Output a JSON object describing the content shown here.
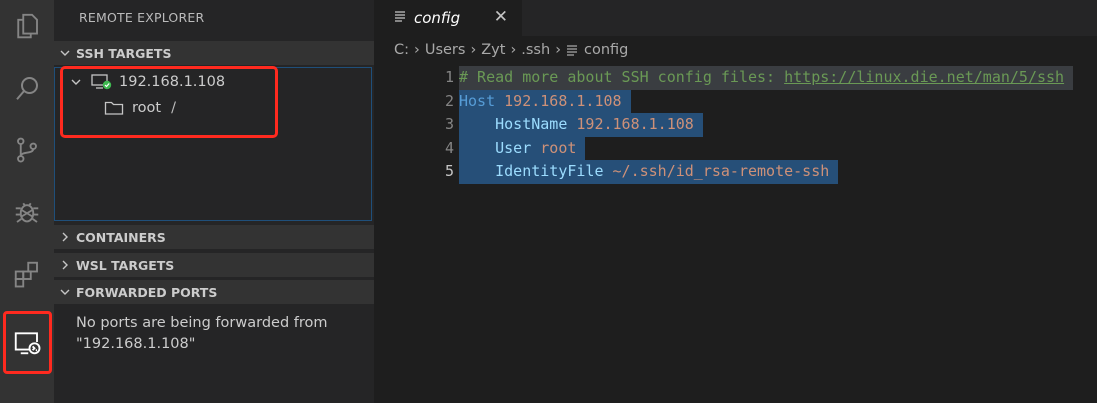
{
  "activity_bar": {
    "items": [
      {
        "icon": "files-icon"
      },
      {
        "icon": "search-icon"
      },
      {
        "icon": "source-control-icon"
      },
      {
        "icon": "debug-icon"
      },
      {
        "icon": "extensions-icon"
      },
      {
        "icon": "remote-explorer-icon",
        "active": true
      }
    ]
  },
  "sidebar": {
    "title": "REMOTE EXPLORER",
    "ssh_targets": {
      "label": "SSH TARGETS",
      "host": "192.168.1.108",
      "folder": "root",
      "folder_path": "/"
    },
    "containers": {
      "label": "CONTAINERS"
    },
    "wsl_targets": {
      "label": "WSL TARGETS"
    },
    "forwarded_ports": {
      "label": "FORWARDED PORTS",
      "message_line1": "No ports are being forwarded from",
      "message_line2": "\"192.168.1.108\""
    }
  },
  "editor": {
    "tab": {
      "label": "config"
    },
    "breadcrumb": [
      "C:",
      "Users",
      "Zyt",
      ".ssh",
      "config"
    ],
    "lines": [
      {
        "num": "1",
        "parts": [
          {
            "t": "# Read more about SSH config files: ",
            "c": "comment"
          },
          {
            "t": "https://linux.die.net/man/5/ssh",
            "c": "link"
          }
        ]
      },
      {
        "num": "2",
        "parts": [
          {
            "t": "Host ",
            "c": "key"
          },
          {
            "t": "192.168.1.108",
            "c": "val"
          }
        ]
      },
      {
        "num": "3",
        "parts": [
          {
            "t": "    HostName ",
            "c": "plain"
          },
          {
            "t": "192.168.1.108",
            "c": "val"
          }
        ]
      },
      {
        "num": "4",
        "parts": [
          {
            "t": "    User ",
            "c": "plain"
          },
          {
            "t": "root",
            "c": "val"
          }
        ]
      },
      {
        "num": "5",
        "parts": [
          {
            "t": "    IdentityFile ",
            "c": "plain"
          },
          {
            "t": "~/.ssh/id_rsa-remote-ssh",
            "c": "val"
          }
        ]
      }
    ]
  },
  "colors": {
    "highlight_box": "#ff2a1f",
    "selection": "#264f78",
    "connected_badge": "#3fb950"
  }
}
